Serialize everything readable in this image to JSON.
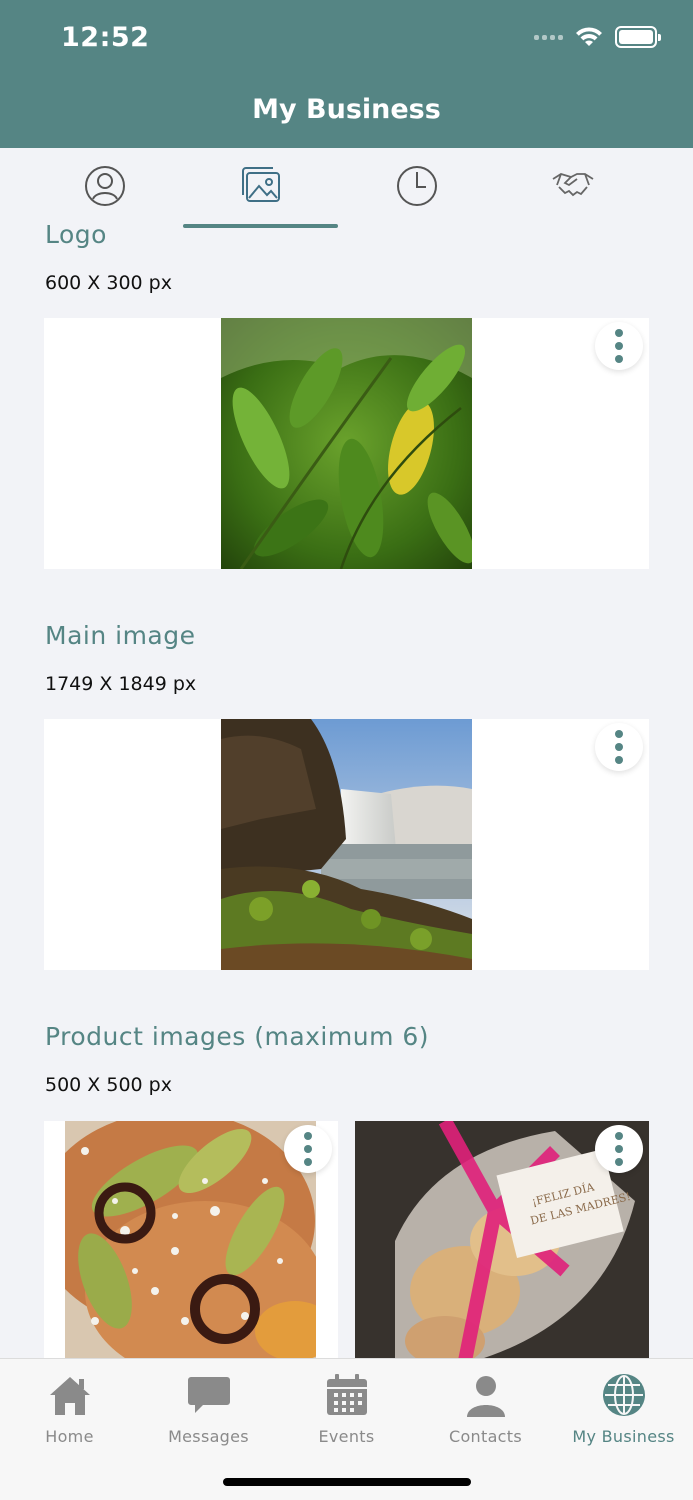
{
  "status": {
    "time": "12:52"
  },
  "header": {
    "title": "My Business"
  },
  "tabs": [
    {
      "icon": "user-circle-icon"
    },
    {
      "icon": "image-gallery-icon",
      "active": true
    },
    {
      "icon": "clock-icon"
    },
    {
      "icon": "handshake-icon"
    }
  ],
  "sections": {
    "logo": {
      "title": "Logo",
      "dims": "600 X 300 px",
      "image": "leaves-photo"
    },
    "main": {
      "title": "Main image",
      "dims": "1749 X 1849 px",
      "image": "waterfall-photo"
    },
    "products": {
      "title": "Product images (maximum 6)",
      "dims": "500 X 500 px",
      "images": [
        "tostadas-photo",
        "cookies-gift-photo"
      ]
    }
  },
  "tabbar": {
    "items": [
      {
        "label": "Home",
        "icon": "home-icon"
      },
      {
        "label": "Messages",
        "icon": "chat-bubble-icon"
      },
      {
        "label": "Events",
        "icon": "calendar-icon"
      },
      {
        "label": "Contacts",
        "icon": "person-icon"
      },
      {
        "label": "My Business",
        "icon": "globe-icon",
        "active": true
      }
    ]
  },
  "colors": {
    "accent": "#558584",
    "background": "#f2f3f7",
    "inactive": "#8a8a8a"
  }
}
